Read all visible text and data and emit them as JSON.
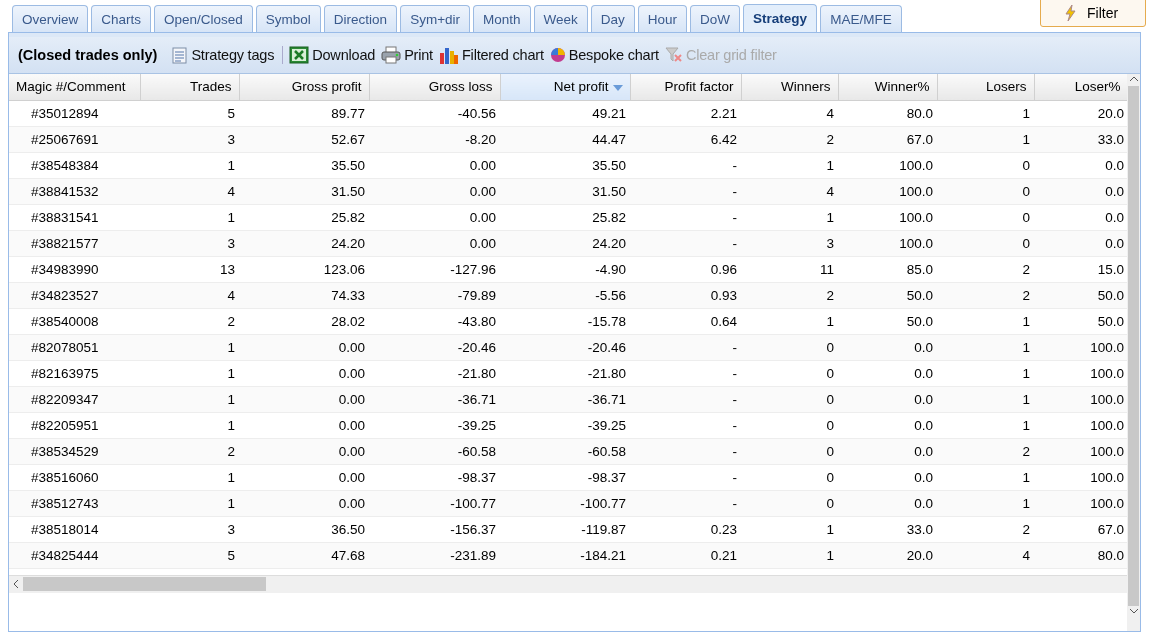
{
  "tabs": [
    {
      "label": "Overview",
      "selected": false
    },
    {
      "label": "Charts",
      "selected": false
    },
    {
      "label": "Open/Closed",
      "selected": false
    },
    {
      "label": "Symbol",
      "selected": false
    },
    {
      "label": "Direction",
      "selected": false
    },
    {
      "label": "Sym+dir",
      "selected": false
    },
    {
      "label": "Month",
      "selected": false
    },
    {
      "label": "Week",
      "selected": false
    },
    {
      "label": "Day",
      "selected": false
    },
    {
      "label": "Hour",
      "selected": false
    },
    {
      "label": "DoW",
      "selected": false
    },
    {
      "label": "Strategy",
      "selected": true
    },
    {
      "label": "MAE/MFE",
      "selected": false
    }
  ],
  "filter_button": {
    "label": "Filter"
  },
  "toolbar": {
    "title": "(Closed trades only)",
    "tools": [
      {
        "kind": "tags",
        "label": "Strategy tags",
        "disabled": false
      },
      {
        "kind": "excel",
        "label": "Download",
        "disabled": false
      },
      {
        "kind": "print",
        "label": "Print",
        "disabled": false
      },
      {
        "kind": "bars",
        "label": "Filtered chart",
        "disabled": false
      },
      {
        "kind": "pie",
        "label": "Bespoke chart",
        "disabled": false
      },
      {
        "kind": "clear-filter",
        "label": "Clear grid filter",
        "disabled": true
      }
    ]
  },
  "table": {
    "columns": [
      {
        "label": "Magic #/Comment",
        "sorted": false
      },
      {
        "label": "Trades",
        "sorted": false
      },
      {
        "label": "Gross profit",
        "sorted": false
      },
      {
        "label": "Gross loss",
        "sorted": false
      },
      {
        "label": "Net profit",
        "sorted": true
      },
      {
        "label": "Profit factor",
        "sorted": false
      },
      {
        "label": "Winners",
        "sorted": false
      },
      {
        "label": "Winner%",
        "sorted": false
      },
      {
        "label": "Losers",
        "sorted": false
      },
      {
        "label": "Loser%",
        "sorted": false
      }
    ],
    "rows": [
      [
        "#35012894",
        "5",
        "89.77",
        "-40.56",
        "49.21",
        "2.21",
        "4",
        "80.0",
        "1",
        "20.0"
      ],
      [
        "#25067691",
        "3",
        "52.67",
        "-8.20",
        "44.47",
        "6.42",
        "2",
        "67.0",
        "1",
        "33.0"
      ],
      [
        "#38548384",
        "1",
        "35.50",
        "0.00",
        "35.50",
        "-",
        "1",
        "100.0",
        "0",
        "0.0"
      ],
      [
        "#38841532",
        "4",
        "31.50",
        "0.00",
        "31.50",
        "-",
        "4",
        "100.0",
        "0",
        "0.0"
      ],
      [
        "#38831541",
        "1",
        "25.82",
        "0.00",
        "25.82",
        "-",
        "1",
        "100.0",
        "0",
        "0.0"
      ],
      [
        "#38821577",
        "3",
        "24.20",
        "0.00",
        "24.20",
        "-",
        "3",
        "100.0",
        "0",
        "0.0"
      ],
      [
        "#34983990",
        "13",
        "123.06",
        "-127.96",
        "-4.90",
        "0.96",
        "11",
        "85.0",
        "2",
        "15.0"
      ],
      [
        "#34823527",
        "4",
        "74.33",
        "-79.89",
        "-5.56",
        "0.93",
        "2",
        "50.0",
        "2",
        "50.0"
      ],
      [
        "#38540008",
        "2",
        "28.02",
        "-43.80",
        "-15.78",
        "0.64",
        "1",
        "50.0",
        "1",
        "50.0"
      ],
      [
        "#82078051",
        "1",
        "0.00",
        "-20.46",
        "-20.46",
        "-",
        "0",
        "0.0",
        "1",
        "100.0"
      ],
      [
        "#82163975",
        "1",
        "0.00",
        "-21.80",
        "-21.80",
        "-",
        "0",
        "0.0",
        "1",
        "100.0"
      ],
      [
        "#82209347",
        "1",
        "0.00",
        "-36.71",
        "-36.71",
        "-",
        "0",
        "0.0",
        "1",
        "100.0"
      ],
      [
        "#82205951",
        "1",
        "0.00",
        "-39.25",
        "-39.25",
        "-",
        "0",
        "0.0",
        "1",
        "100.0"
      ],
      [
        "#38534529",
        "2",
        "0.00",
        "-60.58",
        "-60.58",
        "-",
        "0",
        "0.0",
        "2",
        "100.0"
      ],
      [
        "#38516060",
        "1",
        "0.00",
        "-98.37",
        "-98.37",
        "-",
        "0",
        "0.0",
        "1",
        "100.0"
      ],
      [
        "#38512743",
        "1",
        "0.00",
        "-100.77",
        "-100.77",
        "-",
        "0",
        "0.0",
        "1",
        "100.0"
      ],
      [
        "#38518014",
        "3",
        "36.50",
        "-156.37",
        "-119.87",
        "0.23",
        "1",
        "33.0",
        "2",
        "67.0"
      ],
      [
        "#34825444",
        "5",
        "47.68",
        "-231.89",
        "-184.21",
        "0.21",
        "1",
        "20.0",
        "4",
        "80.0"
      ]
    ]
  }
}
